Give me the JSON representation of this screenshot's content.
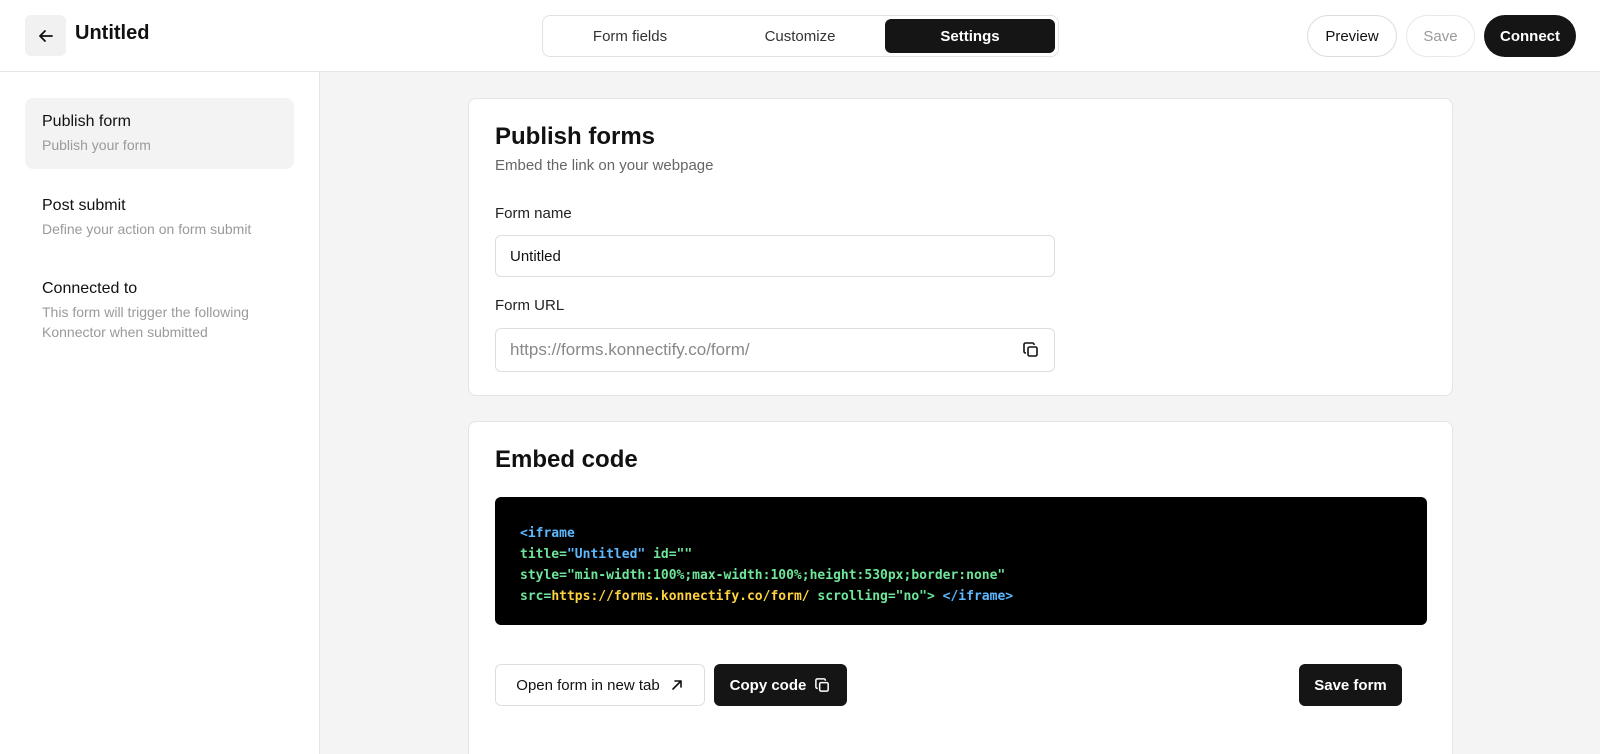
{
  "header": {
    "title": "Untitled",
    "tabs": [
      {
        "label": "Form fields",
        "active": false
      },
      {
        "label": "Customize",
        "active": false
      },
      {
        "label": "Settings",
        "active": true
      }
    ],
    "preview_label": "Preview",
    "save_label": "Save",
    "connect_label": "Connect",
    "back_icon": "arrow-left-icon"
  },
  "sidebar": {
    "items": [
      {
        "title": "Publish form",
        "subtitle": "Publish your form",
        "active": true
      },
      {
        "title": "Post submit",
        "subtitle": "Define your action on form submit",
        "active": false
      },
      {
        "title": "Connected to",
        "subtitle": "This form will trigger the following Konnector when submitted",
        "active": false
      }
    ]
  },
  "publish": {
    "title": "Publish forms",
    "subtitle": "Embed the link on your webpage",
    "form_name_label": "Form name",
    "form_name_value": "Untitled",
    "form_url_label": "Form URL",
    "form_url_value": "https://forms.konnectify.co/form/",
    "copy_icon": "copy-icon"
  },
  "embed": {
    "title": "Embed code",
    "code": {
      "line1_tag": "<iframe",
      "line2_attr_title": "title=",
      "line2_val_title": "\"Untitled\"",
      "line2_attr_id": " id=\"\"",
      "line3": "style=\"min-width:100%;max-width:100%;height:530px;border:none\"",
      "line4_attr_src": "src=",
      "line4_url": "https://forms.konnectify.co/form/",
      "line4_scrolling": " scrolling=\"no\">",
      "line4_close": " </iframe>"
    },
    "open_tab_label": "Open form in new tab",
    "copy_code_label": "Copy code",
    "save_form_label": "Save form"
  },
  "colors": {
    "primary_dark": "#151515",
    "code_bg": "#000000",
    "code_tag": "#5cb8ff",
    "code_attr": "#6ee69a",
    "code_url": "#ffd23f"
  }
}
